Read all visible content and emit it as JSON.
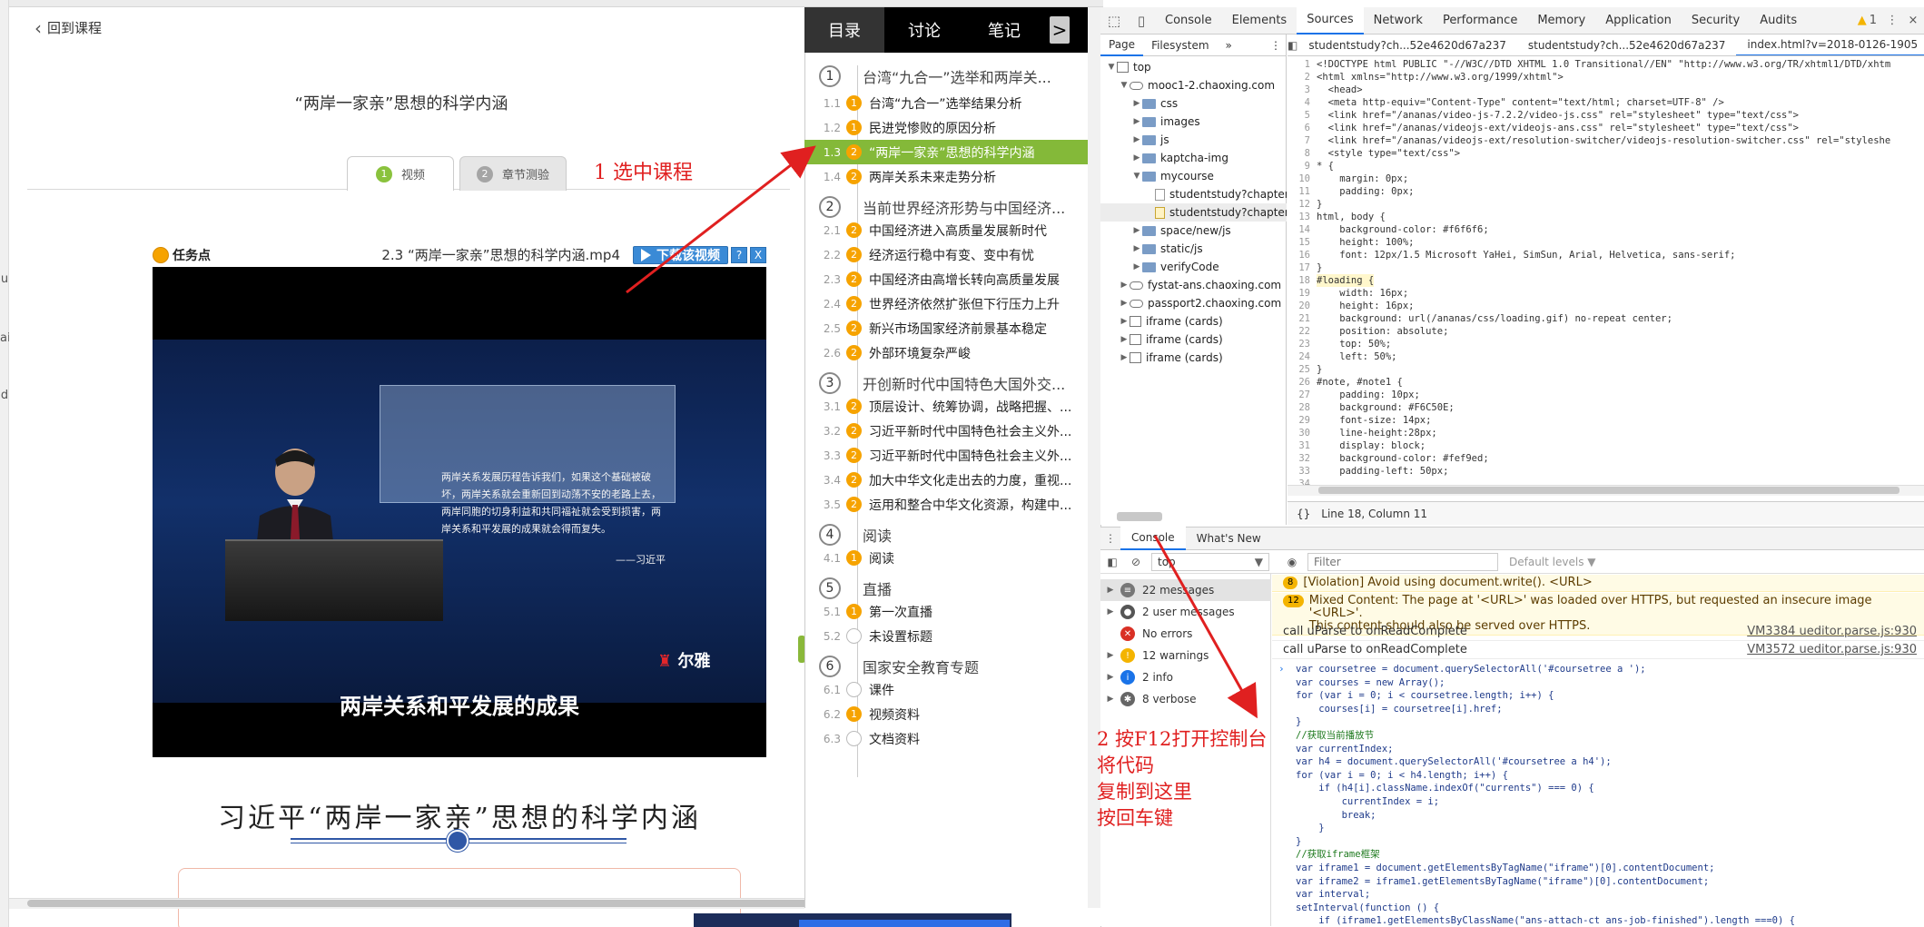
{
  "course": {
    "back_label": "回到课程",
    "title": "“两岸一家亲”思想的科学内涵",
    "tabs": [
      {
        "num": "1",
        "label": "视频"
      },
      {
        "num": "2",
        "label": "章节测验"
      }
    ],
    "task_point_label": "任务点",
    "video_filename": "2.3 “两岸一家亲”思想的科学内涵.mp4",
    "download_label": "下载该视频",
    "help_label": "?",
    "close_label": "X",
    "video_quote": "两岸关系发展历程告诉我们，如果这个基础被破坏，两岸关系就会重新回到动荡不安的老路上去，两岸同胞的切身利益和共同福祉就会受到损害，两岸关系和平发展的成果就会得而复失。",
    "video_signature": "——习近平",
    "video_logo": "尔雅",
    "video_caption": "两岸关系和平发展的成果",
    "article_title": "习近平“两岸一家亲”思想的科学内涵"
  },
  "annotations": {
    "step1": "1 选中课程",
    "step2_lines": [
      "2 按F12打开控制台",
      "将代码",
      "复制到这里",
      "按回车键"
    ]
  },
  "edge_chars": [
    "u",
    "ai",
    "d"
  ],
  "catalog": {
    "tabs": [
      {
        "label": "目录",
        "active": true
      },
      {
        "label": "讨论",
        "active": false
      },
      {
        "label": "笔记",
        "active": false
      }
    ],
    "next_label": ">",
    "rows": [
      {
        "kind": "chapter",
        "num": "1",
        "label": "台湾“九合一”选举和两岸关..."
      },
      {
        "kind": "section",
        "num": "1.1",
        "badge": "1",
        "label": "台湾“九合一”选举结果分析"
      },
      {
        "kind": "section",
        "num": "1.2",
        "badge": "1",
        "label": "民进党惨败的原因分析"
      },
      {
        "kind": "section",
        "num": "1.3",
        "badge": "2",
        "label": "“两岸一家亲”思想的科学内涵",
        "selected": true
      },
      {
        "kind": "section",
        "num": "1.4",
        "badge": "2",
        "label": "两岸关系未来走势分析"
      },
      {
        "kind": "chapter",
        "num": "2",
        "label": "当前世界经济形势与中国经济..."
      },
      {
        "kind": "section",
        "num": "2.1",
        "badge": "2",
        "label": "中国经济进入高质量发展新时代"
      },
      {
        "kind": "section",
        "num": "2.2",
        "badge": "2",
        "label": "经济运行稳中有变、变中有忧"
      },
      {
        "kind": "section",
        "num": "2.3",
        "badge": "2",
        "label": "中国经济由高增长转向高质量发展"
      },
      {
        "kind": "section",
        "num": "2.4",
        "badge": "2",
        "label": "世界经济依然扩张但下行压力上升"
      },
      {
        "kind": "section",
        "num": "2.5",
        "badge": "2",
        "label": "新兴市场国家经济前景基本稳定"
      },
      {
        "kind": "section",
        "num": "2.6",
        "badge": "2",
        "label": "外部环境复杂严峻"
      },
      {
        "kind": "chapter",
        "num": "3",
        "label": "开创新时代中国特色大国外交..."
      },
      {
        "kind": "section",
        "num": "3.1",
        "badge": "2",
        "label": "顶层设计、统筹协调，战略把握、..."
      },
      {
        "kind": "section",
        "num": "3.2",
        "badge": "2",
        "label": "习近平新时代中国特色社会主义外..."
      },
      {
        "kind": "section",
        "num": "3.3",
        "badge": "2",
        "label": "习近平新时代中国特色社会主义外..."
      },
      {
        "kind": "section",
        "num": "3.4",
        "badge": "2",
        "label": "加大中华文化走出去的力度，重视..."
      },
      {
        "kind": "section",
        "num": "3.5",
        "badge": "2",
        "label": "运用和整合中华文化资源，构建中..."
      },
      {
        "kind": "chapter",
        "num": "4",
        "label": "阅读"
      },
      {
        "kind": "section",
        "num": "4.1",
        "badge": "1",
        "label": "阅读"
      },
      {
        "kind": "chapter",
        "num": "5",
        "label": "直播"
      },
      {
        "kind": "section",
        "num": "5.1",
        "badge": "1",
        "label": "第一次直播"
      },
      {
        "kind": "section",
        "num": "5.2",
        "badge": "",
        "label": "未设置标题"
      },
      {
        "kind": "chapter",
        "num": "6",
        "label": "国家安全教育专题"
      },
      {
        "kind": "section",
        "num": "6.1",
        "badge": "",
        "label": "课件"
      },
      {
        "kind": "section",
        "num": "6.2",
        "badge": "1",
        "label": "视频资料"
      },
      {
        "kind": "section",
        "num": "6.3",
        "badge": "",
        "label": "文档资料"
      }
    ]
  },
  "devtools": {
    "tabs": [
      "Console",
      "Elements",
      "Sources",
      "Network",
      "Performance",
      "Memory",
      "Application",
      "Security",
      "Audits"
    ],
    "active_tab": "Sources",
    "warning_count": "1",
    "more_label": "⋮",
    "close_label": "×",
    "navigator_tabs": [
      "Page",
      "Filesystem"
    ],
    "navigator_more": "»",
    "tree": [
      {
        "depth": 0,
        "arrow": "▼",
        "icon": "frame",
        "label": "top"
      },
      {
        "depth": 1,
        "arrow": "▼",
        "icon": "cloud",
        "label": "mooc1-2.chaoxing.com"
      },
      {
        "depth": 2,
        "arrow": "▶",
        "icon": "folder",
        "label": "css"
      },
      {
        "depth": 2,
        "arrow": "▶",
        "icon": "folder",
        "label": "images"
      },
      {
        "depth": 2,
        "arrow": "▶",
        "icon": "folder",
        "label": "js"
      },
      {
        "depth": 2,
        "arrow": "▶",
        "icon": "folder",
        "label": "kaptcha-img"
      },
      {
        "depth": 2,
        "arrow": "▼",
        "icon": "folder",
        "label": "mycourse"
      },
      {
        "depth": 3,
        "arrow": "",
        "icon": "file",
        "label": "studentstudy?chapterId="
      },
      {
        "depth": 3,
        "arrow": "",
        "icon": "file-y",
        "label": "studentstudy?chapterId=",
        "selected": true
      },
      {
        "depth": 2,
        "arrow": "▶",
        "icon": "folder",
        "label": "space/new/js"
      },
      {
        "depth": 2,
        "arrow": "▶",
        "icon": "folder",
        "label": "static/js"
      },
      {
        "depth": 2,
        "arrow": "▶",
        "icon": "folder",
        "label": "verifyCode"
      },
      {
        "depth": 1,
        "arrow": "▶",
        "icon": "cloud",
        "label": "fystat-ans.chaoxing.com"
      },
      {
        "depth": 1,
        "arrow": "▶",
        "icon": "cloud",
        "label": "passport2.chaoxing.com"
      },
      {
        "depth": 1,
        "arrow": "▶",
        "icon": "frame",
        "label": "iframe (cards)"
      },
      {
        "depth": 1,
        "arrow": "▶",
        "icon": "frame",
        "label": "iframe (cards)"
      },
      {
        "depth": 1,
        "arrow": "▶",
        "icon": "frame",
        "label": "iframe (cards)"
      }
    ],
    "source_tabs": [
      {
        "label": "studentstudy?ch...52e4620d67a237",
        "active": false
      },
      {
        "label": "studentstudy?ch...52e4620d67a237",
        "active": false
      },
      {
        "label": "index.html?v=2018-0126-1905",
        "active": true
      }
    ],
    "source_tab_close": "×",
    "code_lines": [
      "<!DOCTYPE html PUBLIC \"-//W3C//DTD XHTML 1.0 Transitional//EN\" \"http://www.w3.org/TR/xhtml1/DTD/xhtm",
      "<html xmlns=\"http://www.w3.org/1999/xhtml\">",
      "  <head>",
      "  <meta http-equiv=\"Content-Type\" content=\"text/html; charset=UTF-8\" />",
      "  <link href=\"/ananas/video-js-7.2.2/video-js.css\" rel=\"stylesheet\" type=\"text/css\">",
      "  <link href=\"/ananas/videojs-ext/videojs-ans.css\" rel=\"stylesheet\" type=\"text/css\">",
      "  <link href=\"/ananas/videojs-ext/resolution-switcher/videojs-resolution-switcher.css\" rel=\"styleshe",
      "  <style type=\"text/css\">",
      "* {",
      "    margin: 0px;",
      "    padding: 0px;",
      "}",
      "html, body {",
      "    background-color: #f6f6f6;",
      "    height: 100%;",
      "    font: 12px/1.5 Microsoft YaHei, SimSun, Arial, Helvetica, sans-serif;",
      "}",
      "#loading {",
      "    width: 16px;",
      "    height: 16px;",
      "    background: url(/ananas/css/loading.gif) no-repeat center;",
      "    position: absolute;",
      "    top: 50%;",
      "    left: 50%;",
      "}",
      "#note, #note1 {",
      "    padding: 10px;",
      "    background: #F6C50E;",
      "    font-size: 14px;",
      "    line-height:28px;",
      "    display: block;",
      "    background-color: #fef9ed;",
      "    padding-left: 50px;",
      ""
    ],
    "status_braces": "{}",
    "status_text": "Line 18, Column 11",
    "drawer_tabs": [
      "Console",
      "What's New"
    ],
    "context_label": "top",
    "filter_placeholder": "Filter",
    "levels_label": "Default levels ▼",
    "sidebar": [
      {
        "label": "22 messages",
        "icon": "list",
        "selected": true
      },
      {
        "label": "2 user messages",
        "icon": "user"
      },
      {
        "label": "No errors",
        "icon": "error"
      },
      {
        "label": "12 warnings",
        "icon": "warning"
      },
      {
        "label": "2 info",
        "icon": "info"
      },
      {
        "label": "8 verbose",
        "icon": "verbose"
      }
    ],
    "messages": [
      {
        "kind": "warn",
        "badge": "8",
        "text": "[Violation] Avoid using document.write(). <URL>",
        "src": ""
      },
      {
        "kind": "warn",
        "badge": "12",
        "text": "Mixed Content: The page at '<URL>' was loaded over HTTPS, but requested an insecure image '<URL>'.\nThis content should also be served over HTTPS.",
        "src": ""
      },
      {
        "kind": "log",
        "badge": "",
        "text": "call uParse to onReadComplete",
        "src": "VM3384 ueditor.parse.js:930"
      },
      {
        "kind": "log",
        "badge": "",
        "text": "call uParse to onReadComplete",
        "src": "VM3572 ueditor.parse.js:930"
      }
    ],
    "input_prompt": "›",
    "input_code": [
      "var coursetree = document.querySelectorAll('#coursetree a ');",
      "var courses = new Array();",
      "for (var i = 0; i < coursetree.length; i++) {",
      "    courses[i] = coursetree[i].href;",
      "}",
      "//获取当前播放节",
      "var currentIndex;",
      "var h4 = document.querySelectorAll('#coursetree a h4');",
      "for (var i = 0; i < h4.length; i++) {",
      "    if (h4[i].className.indexOf(\"currents\") === 0) {",
      "        currentIndex = i;",
      "        break;",
      "    }",
      "}",
      "//获取iframe框架",
      "var iframe1 = document.getElementsByTagName(\"iframe\")[0].contentDocument;",
      "var iframe2 = iframe1.getElementsByTagName(\"iframe\")[0].contentDocument;",
      "var interval;",
      "setInterval(function () {",
      "    if (iframe1.getElementsByClassName(\"ans-attach-ct ans-job-finished\").length ===0) {"
    ]
  },
  "colors": {
    "accent_green": "#84b939",
    "badge_orange": "#f6a300",
    "devtools_blue": "#1a73e8",
    "annotation_red": "#e02020"
  }
}
